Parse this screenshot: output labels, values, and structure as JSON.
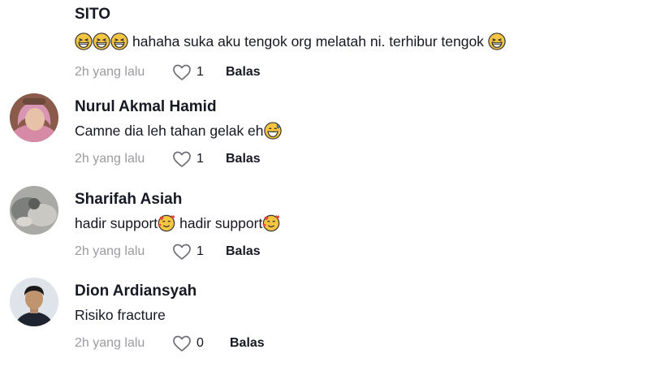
{
  "comments": [
    {
      "username": "SITO",
      "has_avatar": false,
      "text_prefix_emojis": [
        "grinning-squinting-face-emoji",
        "grinning-squinting-face-emoji",
        "grinning-squinting-face-emoji"
      ],
      "text": "hahaha suka aku tengok org melatah ni. terhibur tengok",
      "text_suffix_emoji": "grinning-squinting-face-emoji",
      "time": "2h yang lalu",
      "likes": "1",
      "reply_label": "Balas"
    },
    {
      "username": "Nurul Akmal Hamid",
      "has_avatar": true,
      "text": "Camne dia leh tahan gelak eh",
      "text_suffix_emoji": "grinning-sweat-face-emoji",
      "time": "2h yang lalu",
      "likes": "1",
      "reply_label": "Balas"
    },
    {
      "username": "Sharifah Asiah",
      "has_avatar": true,
      "text_part1": "hadir support",
      "text_part2": "hadir support",
      "text_emoji": "smiling-face-with-hearts-emoji",
      "time": "2h yang lalu",
      "likes": "1",
      "reply_label": "Balas"
    },
    {
      "username": "Dion Ardiansyah",
      "has_avatar": true,
      "text": "Risiko fracture",
      "time": "2h yang lalu",
      "likes": "0",
      "reply_label": "Balas"
    }
  ],
  "colors": {
    "text": "#161823",
    "secondary": "#9a9ba0",
    "emoji_yellow": "#f6c542"
  },
  "icons": {
    "like": "heart-outline-icon"
  }
}
